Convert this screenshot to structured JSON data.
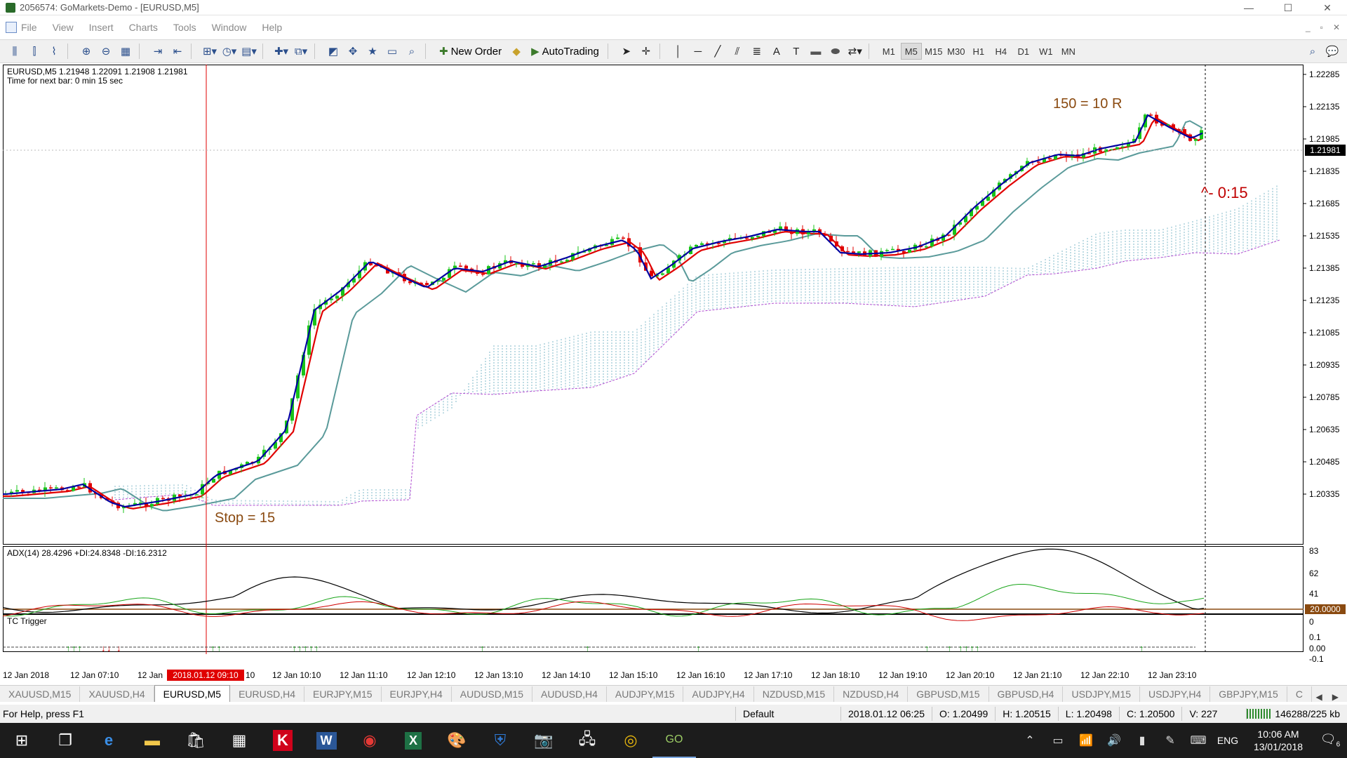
{
  "window": {
    "title": "2056574: GoMarkets-Demo - [EURUSD,M5]",
    "controls": [
      "—",
      "☐",
      "✕"
    ]
  },
  "menu": [
    "File",
    "View",
    "Insert",
    "Charts",
    "Tools",
    "Window",
    "Help"
  ],
  "toolbar": {
    "new_order_label": "New Order",
    "autotrading_label": "AutoTrading",
    "timeframes": [
      "M1",
      "M5",
      "M15",
      "M30",
      "H1",
      "H4",
      "D1",
      "W1",
      "MN"
    ],
    "active_timeframe": "M5"
  },
  "chart": {
    "header": "EURUSD,M5  1.21948 1.22091 1.21908 1.21981",
    "next_bar": "Time for next bar: 0 min 15 sec",
    "annotation_target": "150 = 10 R",
    "annotation_stop": "Stop = 15",
    "countdown_label": "^- 0:15",
    "current_price": "1.21981",
    "price_axis": [
      "1.22285",
      "1.22135",
      "1.21985",
      "1.21835",
      "1.21685",
      "1.21535",
      "1.21385",
      "1.21235",
      "1.21085",
      "1.20935",
      "1.20785",
      "1.20635",
      "1.20485",
      "1.20335"
    ],
    "time_axis": [
      "12 Jan 2018",
      "12 Jan 07:10",
      "12 Jan",
      "12 Jan 10:10",
      "12 Jan 11:10",
      "12 Jan 12:10",
      "12 Jan 13:10",
      "12 Jan 14:10",
      "12 Jan 15:10",
      "12 Jan 16:10",
      "12 Jan 17:10",
      "12 Jan 18:10",
      "12 Jan 19:10",
      "12 Jan 20:10",
      "12 Jan 21:10",
      "12 Jan 22:10",
      "12 Jan 23:10"
    ],
    "crosshair_time": "2018.01.12 09:10",
    "crosshair_time_suffix": "10",
    "adx_label": "ADX(14) 28.4296 +DI:24.8348 -DI:16.2312",
    "adx_axis": [
      "83",
      "62",
      "41",
      "20",
      "0"
    ],
    "adx_level": "20.0000",
    "tc_label": "TC Trigger",
    "tc_axis": [
      "0.1",
      "0.00",
      "-0.1"
    ],
    "colors": {
      "bull": "#19c419",
      "bear": "#e00000",
      "ma_fast": "#0000a0",
      "ma_mid": "#e00000",
      "ma_slow": "#5a9a9a",
      "cloud": "#7fb8c8",
      "cloud_edge": "#b04ad0",
      "annotation": "#8a4a10",
      "countdown": "#c00000"
    }
  },
  "symbol_tabs": [
    "XAUUSD,M15",
    "XAUUSD,H4",
    "EURUSD,M5",
    "EURUSD,H4",
    "EURJPY,M15",
    "EURJPY,H4",
    "AUDUSD,M15",
    "AUDUSD,H4",
    "AUDJPY,M15",
    "AUDJPY,H4",
    "NZDUSD,M15",
    "NZDUSD,H4",
    "GBPUSD,M15",
    "GBPUSD,H4",
    "USDJPY,M15",
    "USDJPY,H4",
    "GBPJPY,M15",
    "C"
  ],
  "active_symbol_tab": "EURUSD,M5",
  "status": {
    "help": "For Help, press F1",
    "profile": "Default",
    "datetime": "2018.01.12 06:25",
    "open": "O: 1.20499",
    "high": "H: 1.20515",
    "low": "L: 1.20498",
    "close": "C: 1.20500",
    "volume": "V: 227",
    "traffic": "146288/225 kb"
  },
  "taskbar": {
    "lang": "ENG",
    "time": "10:06 AM",
    "date": "13/01/2018",
    "notifications": "6"
  }
}
